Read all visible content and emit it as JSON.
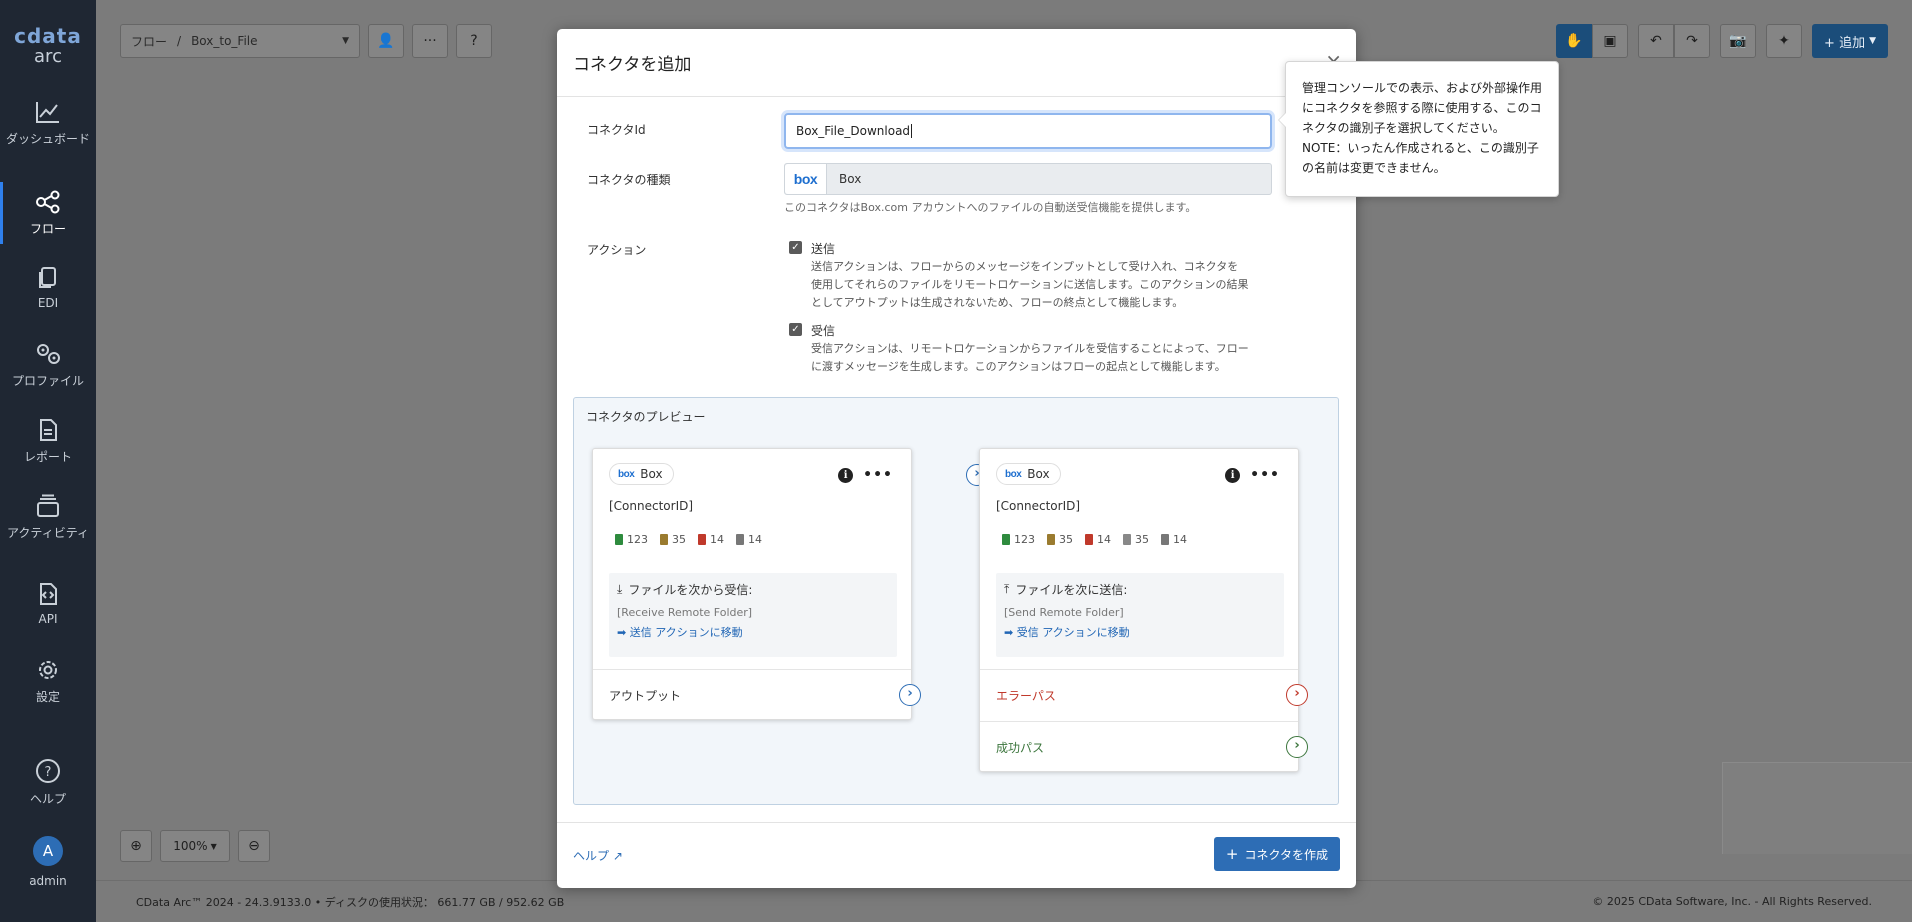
{
  "sidebar": {
    "logo_top": "cdata",
    "logo_bottom": "arc",
    "items": [
      {
        "label": "ダッシュボード",
        "icon": "chart-line-icon"
      },
      {
        "label": "フロー",
        "icon": "flow-icon"
      },
      {
        "label": "EDI",
        "icon": "documents-icon"
      },
      {
        "label": "プロファイル",
        "icon": "gears-icon"
      },
      {
        "label": "レポート",
        "icon": "report-icon"
      },
      {
        "label": "アクティビティ",
        "icon": "activity-icon"
      },
      {
        "label": "API",
        "icon": "api-icon"
      },
      {
        "label": "設定",
        "icon": "gear-icon"
      }
    ],
    "help_label": "ヘルプ",
    "user_initial": "A",
    "user_name": "admin"
  },
  "toolbar": {
    "breadcrumb_root": "フロー",
    "breadcrumb_sep": "/",
    "flow_name": "Box_to_File",
    "add_label": "+ 追加"
  },
  "zoom": {
    "level": "100%"
  },
  "footer": {
    "version": "CData Arc™ 2024 - 24.3.9133.0  •  ディスクの使用状況： 661.77 GB / 952.62 GB",
    "copyright": "© 2025 CData Software, Inc. - All Rights Reserved."
  },
  "modal": {
    "title": "コネクタを追加",
    "connector_id_label": "コネクタId",
    "connector_id_value": "Box_File_Download",
    "connector_type_label": "コネクタの種類",
    "connector_type_logo": "box",
    "connector_type_value": "Box",
    "connector_type_desc": "このコネクタはBox.com アカウントへのファイルの自動送受信機能を提供します。",
    "actions_label": "アクション",
    "actions": [
      {
        "title": "送信",
        "checked": true,
        "desc": "送信アクションは、フローからのメッセージをインプットとして受け入れ、コネクタを使用してそれらのファイルをリモートロケーションに送信します。このアクションの結果としてアウトプットは生成されないため、フローの終点として機能します。"
      },
      {
        "title": "受信",
        "checked": true,
        "desc": "受信アクションは、リモートロケーションからファイルを受信することによって、フローに渡すメッセージを生成します。このアクションはフローの起点として機能します。"
      }
    ],
    "preview_label": "コネクタのプレビュー",
    "cards": [
      {
        "chip_logo": "box",
        "chip_label": "Box",
        "connector_id": "[ConnectorID]",
        "badges": [
          {
            "value": "123",
            "color": "#2e8b3e"
          },
          {
            "value": "35",
            "color": "#9a7b2f"
          },
          {
            "value": "14",
            "color": "#c0392b"
          },
          {
            "value": "14",
            "color": "#777777"
          }
        ],
        "loc_title": "ファイルを次から受信:",
        "loc_path": "[Receive Remote Folder]",
        "loc_link": "➡ 送信 アクションに移動",
        "rows": [
          {
            "label": "アウトプット",
            "color": "#333333"
          }
        ]
      },
      {
        "chip_logo": "box",
        "chip_label": "Box",
        "connector_id": "[ConnectorID]",
        "badges": [
          {
            "value": "123",
            "color": "#2e8b3e"
          },
          {
            "value": "35",
            "color": "#9a7b2f"
          },
          {
            "value": "14",
            "color": "#c0392b"
          },
          {
            "value": "35",
            "color": "#888888"
          },
          {
            "value": "14",
            "color": "#777777"
          }
        ],
        "loc_title": "ファイルを次に送信:",
        "loc_path": "[Send Remote Folder]",
        "loc_link": "➡ 受信 アクションに移動",
        "rows": [
          {
            "label": "エラーパス",
            "color": "#c0392b"
          },
          {
            "label": "成功パス",
            "color": "#3c763d"
          }
        ]
      }
    ],
    "help_link": "ヘルプ",
    "create_button": "コネクタを作成"
  },
  "tooltip": {
    "text": "管理コンソールでの表示、および外部操作用にコネクタを参照する際に使用する、このコネクタの識別子を選択してください。NOTE：いったん作成されると、この識別子の名前は変更できません。"
  }
}
